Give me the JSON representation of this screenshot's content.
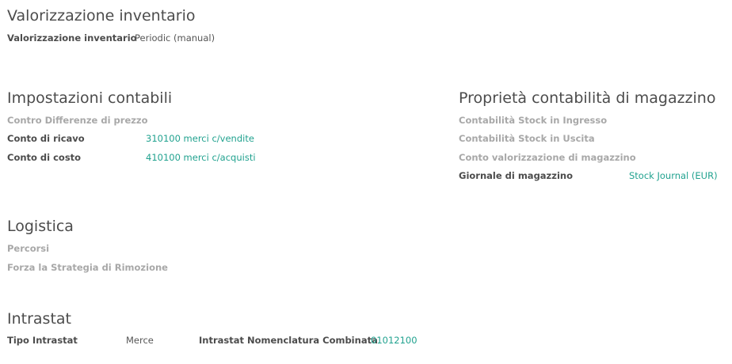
{
  "inventory_valuation": {
    "title": "Valorizzazione inventario",
    "field_label": "Valorizzazione inventario",
    "field_value": "Periodic (manual)"
  },
  "accounting": {
    "title": "Impostazioni contabili",
    "price_difference_label": "Contro Differenze di prezzo",
    "income_label": "Conto di ricavo",
    "income_value": "310100 merci c/vendite",
    "expense_label": "Conto di costo",
    "expense_value": "410100 merci c/acquisti"
  },
  "stock_accounting": {
    "title": "Proprietà contabilità di magazzino",
    "input_label": "Contabilità Stock in Ingresso",
    "output_label": "Contabilità Stock in Uscita",
    "valuation_label": "Conto valorizzazione di magazzino",
    "journal_label": "Giornale di magazzino",
    "journal_value": "Stock Journal (EUR)"
  },
  "logistics": {
    "title": "Logistica",
    "routes_label": "Percorsi",
    "removal_label": "Forza la Strategia di Rimozione"
  },
  "intrastat": {
    "title": "Intrastat",
    "type_label": "Tipo Intrastat",
    "type_value": "Merce",
    "code_label": "Intrastat Nomenclatura Combinata",
    "code_value": "01012100"
  },
  "colors": {
    "link": "#21a28f",
    "muted_label": "#a8a8a8",
    "text": "#4c4c4c"
  }
}
